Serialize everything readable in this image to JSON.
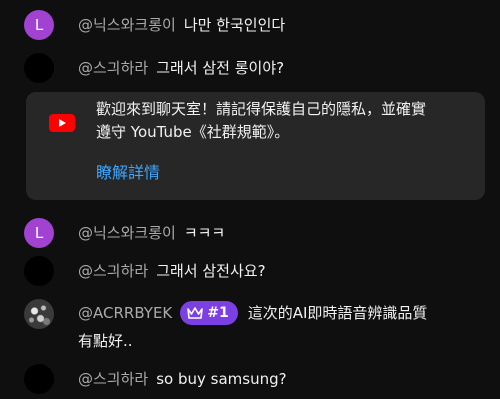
{
  "colors": {
    "background": "#0f0f0f",
    "author": "#aaaaaa",
    "text": "#f1f1f1",
    "link": "#3ea6ff",
    "banner_bg": "#272727",
    "badge_bg": "#7b3fe4",
    "avatar_purple": "#a142d1",
    "youtube_red": "#ff0000"
  },
  "messages": [
    {
      "avatar": "L",
      "author": "@닉스와크롱이",
      "text": "나만 한국인인다"
    },
    {
      "avatar": "",
      "author": "@스긔하라",
      "text": "그래서 삼전 롱이야?"
    },
    {
      "avatar": "L",
      "author": "@닉스와크롱이",
      "text": "ㅋㅋㅋ"
    },
    {
      "avatar": "",
      "author": "@스긔하라",
      "text": "그래서 삼전사요?"
    },
    {
      "avatar": "",
      "author": "@ACRRBYEK",
      "badge": "#1",
      "text_line1": "這次的AI即時語音辨識品質",
      "text_line2": "有點好.."
    },
    {
      "avatar": "",
      "author": "@스긔하라",
      "text": "so buy samsung?"
    }
  ],
  "banner": {
    "icon": "youtube-icon",
    "line1": "歡迎來到聊天室！請記得保護自己的隱私，並確實",
    "line2": "遵守 YouTube《社群規範》。",
    "link": "瞭解詳情"
  }
}
